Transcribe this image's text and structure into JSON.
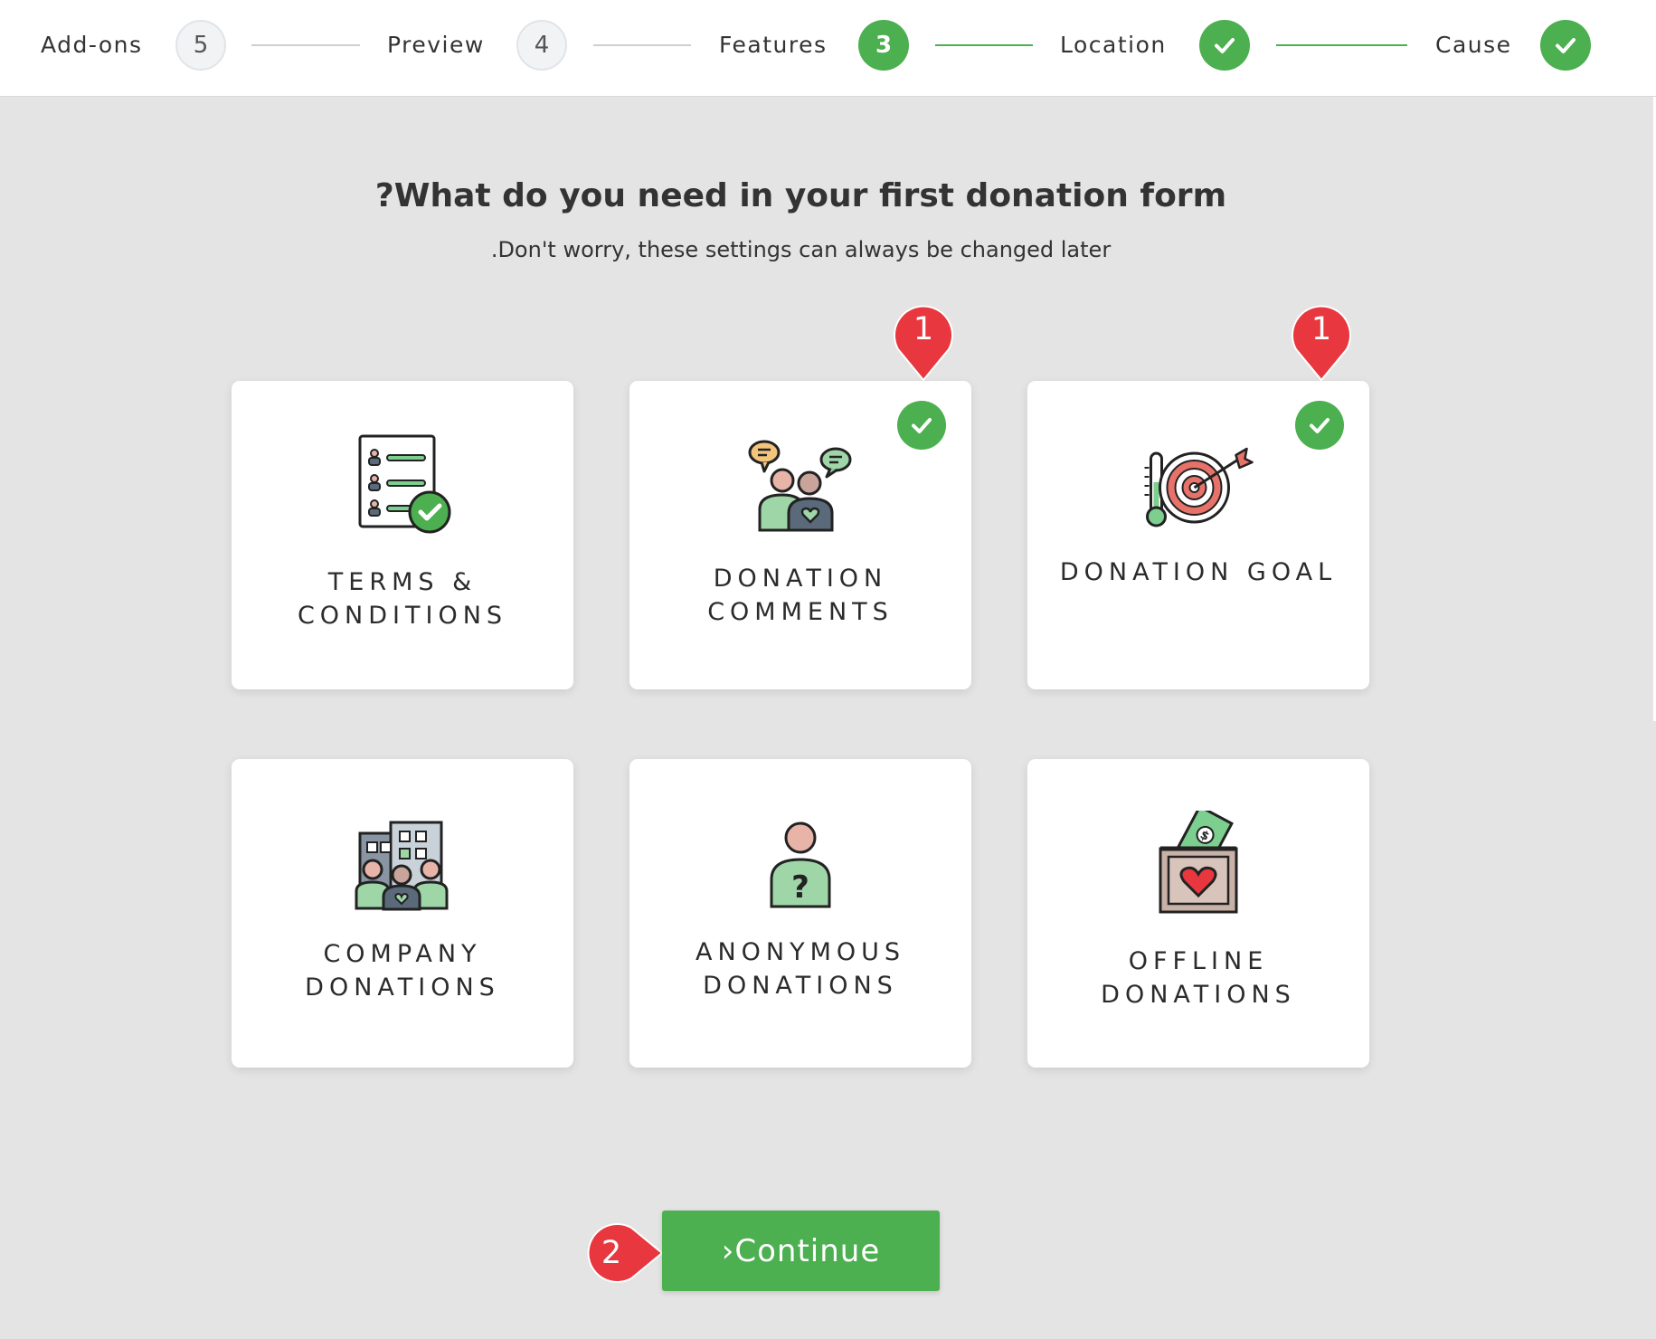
{
  "stepper": {
    "steps": [
      {
        "label": "Add-ons",
        "number": "5",
        "state": "pending"
      },
      {
        "label": "Preview",
        "number": "4",
        "state": "pending"
      },
      {
        "label": "Features",
        "number": "3",
        "state": "current"
      },
      {
        "label": "Location",
        "number": "",
        "state": "done"
      },
      {
        "label": "Cause",
        "number": "",
        "state": "done"
      }
    ]
  },
  "heading": {
    "title": "?What do you need in your first donation form",
    "subtitle": ".Don't worry, these settings can always be changed later"
  },
  "cards": [
    {
      "label": "TERMS & CONDITIONS",
      "icon": "terms-checklist-icon",
      "selected": false
    },
    {
      "label": "DONATION COMMENTS",
      "icon": "donation-comments-icon",
      "selected": true
    },
    {
      "label": "DONATION GOAL",
      "icon": "target-goal-icon",
      "selected": true
    },
    {
      "label": "COMPANY DONATIONS",
      "icon": "company-building-icon",
      "selected": false
    },
    {
      "label": "ANONYMOUS DONATIONS",
      "icon": "anonymous-person-icon",
      "selected": false
    },
    {
      "label": "OFFLINE DONATIONS",
      "icon": "donation-box-icon",
      "selected": false
    }
  ],
  "callouts": [
    {
      "number": "1"
    },
    {
      "number": "1"
    },
    {
      "number": "2"
    }
  ],
  "continue_button": {
    "label": "›Continue"
  },
  "colors": {
    "accent": "#4caf50",
    "callout": "#e8373e",
    "background": "#e4e4e4"
  }
}
